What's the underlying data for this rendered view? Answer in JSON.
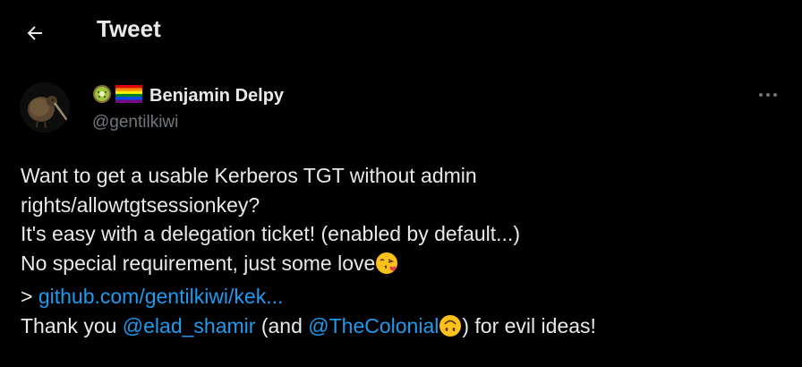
{
  "header": {
    "title": "Tweet",
    "back_icon": "arrow-left-icon"
  },
  "author": {
    "display_name": "Benjamin Delpy",
    "handle": "@gentilkiwi",
    "name_emojis": [
      "kiwi-emoji",
      "rainbow-flag-emoji"
    ]
  },
  "tweet": {
    "line1": "Want to get a usable Kerberos TGT without admin",
    "line2": "rights/allowtgtsessionkey?",
    "line3": "It's easy with a delegation ticket! (enabled by default...)",
    "line4": "No special requirement, just some love",
    "line5_prefix": "> ",
    "line5_link": "github.com/gentilkiwi/kek...",
    "line6_a": "Thank you ",
    "line6_mention1": "@elad_shamir",
    "line6_b": " (and ",
    "line6_mention2": "@TheColonial",
    "line6_c": ") for evil ideas!"
  },
  "colors": {
    "background": "#000000",
    "text": "#e7e9ea",
    "secondary": "#71767b",
    "link": "#1d9bf0"
  }
}
